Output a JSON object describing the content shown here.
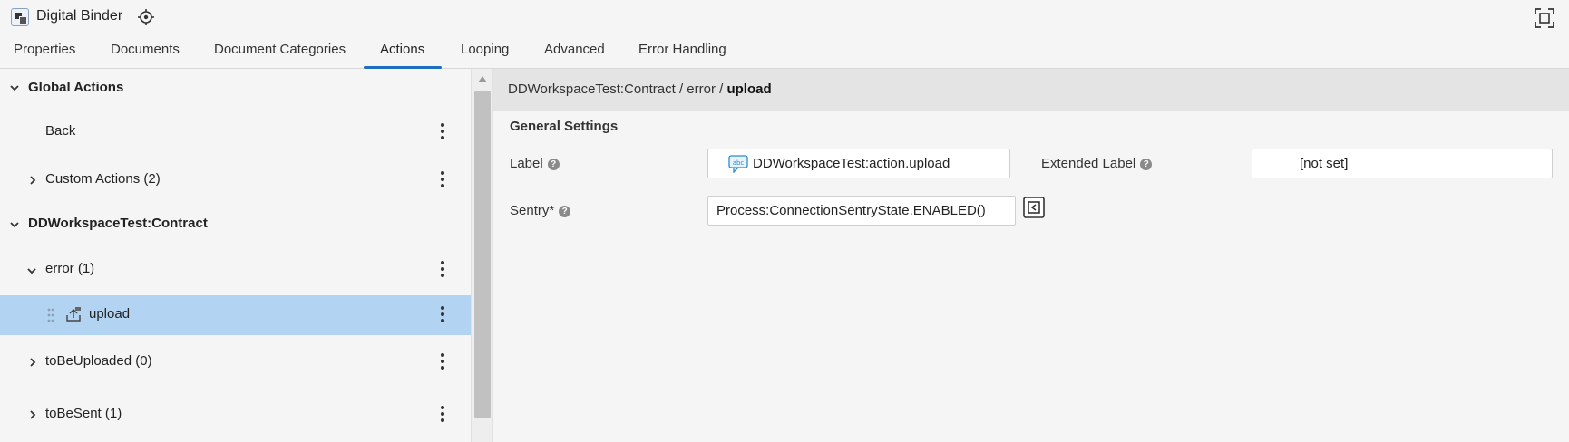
{
  "app": {
    "title": "Digital Binder"
  },
  "tabs": [
    {
      "label": "Properties",
      "active": false
    },
    {
      "label": "Documents",
      "active": false
    },
    {
      "label": "Document Categories",
      "active": false
    },
    {
      "label": "Actions",
      "active": true
    },
    {
      "label": "Looping",
      "active": false
    },
    {
      "label": "Advanced",
      "active": false
    },
    {
      "label": "Error Handling",
      "active": false
    }
  ],
  "tree": {
    "global_actions": "Global Actions",
    "back": "Back",
    "custom_actions": "Custom Actions (2)",
    "contract": "DDWorkspaceTest:Contract",
    "error": "error (1)",
    "upload": "upload",
    "to_be_uploaded": "toBeUploaded (0)",
    "to_be_sent": "toBeSent (1)"
  },
  "breadcrumb": {
    "prefix": "DDWorkspaceTest:Contract / error / ",
    "current": "upload"
  },
  "settings": {
    "section_title": "General Settings",
    "label_label": "Label",
    "label_value": "DDWorkspaceTest:action.upload",
    "extended_label_label": "Extended Label",
    "extended_label_value": "[not set]",
    "sentry_label": "Sentry*",
    "sentry_value": "Process:ConnectionSentryState.ENABLED()"
  },
  "colors": {
    "accent": "#1e6fc0",
    "selected_row": "#b3d3f2"
  }
}
